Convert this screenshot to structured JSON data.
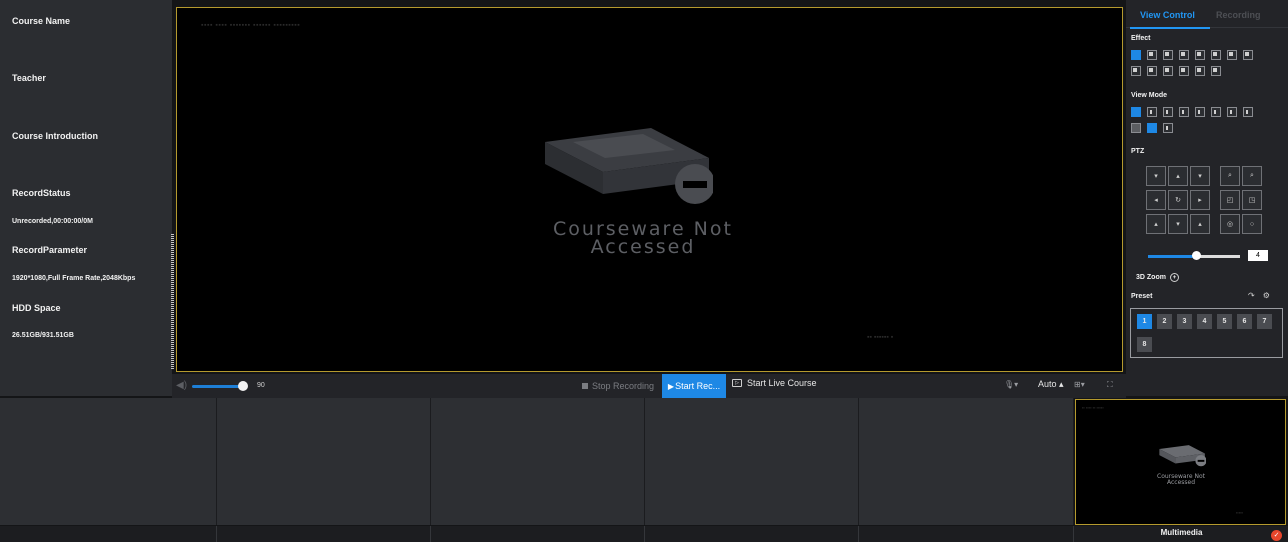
{
  "left_panel": {
    "course_name_label": "Course Name",
    "teacher_label": "Teacher",
    "course_intro_label": "Course Introduction",
    "record_status_label": "RecordStatus",
    "record_status_value": "Unrecorded,00:00:00/0M",
    "record_param_label": "RecordParameter",
    "record_param_value": "1920*1080,Full Frame Rate,2048Kbps",
    "hdd_label": "HDD Space",
    "hdd_value": "26.51GB/931.51GB"
  },
  "video": {
    "placeholder_line1": "Courseware Not",
    "placeholder_line2": "Accessed"
  },
  "control_bar": {
    "volume_value": "90",
    "volume_level": 0.9,
    "stop_recording_label": "Stop Recording",
    "start_record_label": "Start Rec...",
    "start_live_label": "Start Live Course",
    "auto_label": "Auto"
  },
  "right_panel": {
    "tab_view_control": "View Control",
    "tab_recording": "Recording",
    "effect_label": "Effect",
    "view_mode_label": "View Mode",
    "ptz_label": "PTZ",
    "ptz_speed_value": "4",
    "zoom3d_label": "3D Zoom",
    "preset_label": "Preset",
    "presets": [
      "1",
      "2",
      "3",
      "4",
      "5",
      "6",
      "7",
      "8"
    ]
  },
  "multimedia": {
    "label": "Multimedia",
    "placeholder_line1": "Courseware Not",
    "placeholder_line2": "Accessed"
  },
  "colors": {
    "accent": "#1e88e5",
    "frame": "#b59a2e",
    "status_error": "#e8462c"
  }
}
